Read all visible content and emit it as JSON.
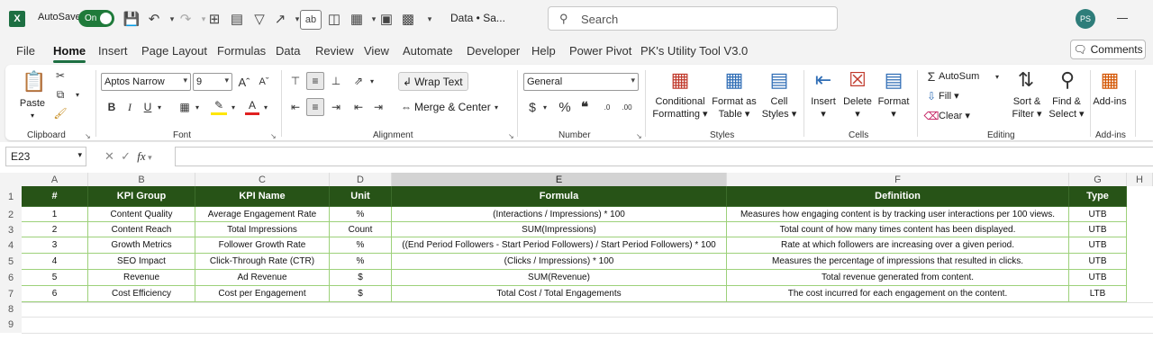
{
  "titlebar": {
    "autosave_label": "AutoSave",
    "autosave_state": "On",
    "doc_title": "Data • Sa...",
    "search_placeholder": "Search",
    "user_initials": "PS"
  },
  "menus": [
    "File",
    "Home",
    "Insert",
    "Page Layout",
    "Formulas",
    "Data",
    "Review",
    "View",
    "Automate",
    "Developer",
    "Help",
    "Power Pivot",
    "PK's Utility Tool V3.0"
  ],
  "active_menu": "Home",
  "comments_label": "Comments",
  "ribbon": {
    "clipboard": {
      "paste": "Paste",
      "group": "Clipboard"
    },
    "font": {
      "name": "Aptos Narrow",
      "size": "9",
      "group": "Font"
    },
    "alignment": {
      "wrap_text": "Wrap Text",
      "merge_center": "Merge & Center",
      "group": "Alignment"
    },
    "number": {
      "format": "General",
      "group": "Number"
    },
    "styles": {
      "conditional": "Conditional",
      "formatting": "Formatting",
      "format_as": "Format as",
      "table": "Table",
      "cell": "Cell",
      "cell_styles": "Styles",
      "group": "Styles"
    },
    "cells": {
      "insert": "Insert",
      "delete": "Delete",
      "format": "Format",
      "group": "Cells"
    },
    "editing": {
      "autosum": "AutoSum",
      "fill": "Fill",
      "clear": "Clear",
      "sort_filter_1": "Sort &",
      "sort_filter_2": "Filter",
      "find_select_1": "Find &",
      "find_select_2": "Select",
      "group": "Editing"
    },
    "addins": {
      "label": "Add-ins",
      "group": "Add-ins"
    }
  },
  "formula_bar": {
    "name_box": "E23",
    "fx": "fx",
    "value": ""
  },
  "columns": [
    "A",
    "B",
    "C",
    "D",
    "E",
    "F",
    "G",
    "H"
  ],
  "selected_column": "E",
  "rows": [
    "1",
    "2",
    "3",
    "4",
    "5",
    "6",
    "7",
    "8",
    "9"
  ],
  "table": {
    "headers": [
      "#",
      "KPI Group",
      "KPI Name",
      "Unit",
      "Formula",
      "Definition",
      "Type"
    ],
    "data": [
      [
        "1",
        "Content Quality",
        "Average Engagement Rate",
        "%",
        "(Interactions / Impressions) * 100",
        "Measures how engaging content is by tracking user interactions per 100 views.",
        "UTB"
      ],
      [
        "2",
        "Content Reach",
        "Total Impressions",
        "Count",
        "SUM(Impressions)",
        "Total count of how many times content has been displayed.",
        "UTB"
      ],
      [
        "3",
        "Growth Metrics",
        "Follower Growth Rate",
        "%",
        "((End Period Followers - Start Period Followers) / Start Period Followers) * 100",
        "Rate at which followers are increasing over a given period.",
        "UTB"
      ],
      [
        "4",
        "SEO Impact",
        "Click-Through Rate (CTR)",
        "%",
        "(Clicks / Impressions) * 100",
        "Measures the percentage of impressions that resulted in clicks.",
        "UTB"
      ],
      [
        "5",
        "Revenue",
        "Ad Revenue",
        "$",
        "SUM(Revenue)",
        "Total revenue generated from content.",
        "UTB"
      ],
      [
        "6",
        "Cost Efficiency",
        "Cost per Engagement",
        "$",
        "Total Cost / Total Engagements",
        "The cost incurred for each engagement on the content.",
        "LTB"
      ]
    ]
  },
  "colors": {
    "header_fill": "#275317",
    "border_green": "#9dd17a",
    "excel_green": "#1d6f42"
  }
}
